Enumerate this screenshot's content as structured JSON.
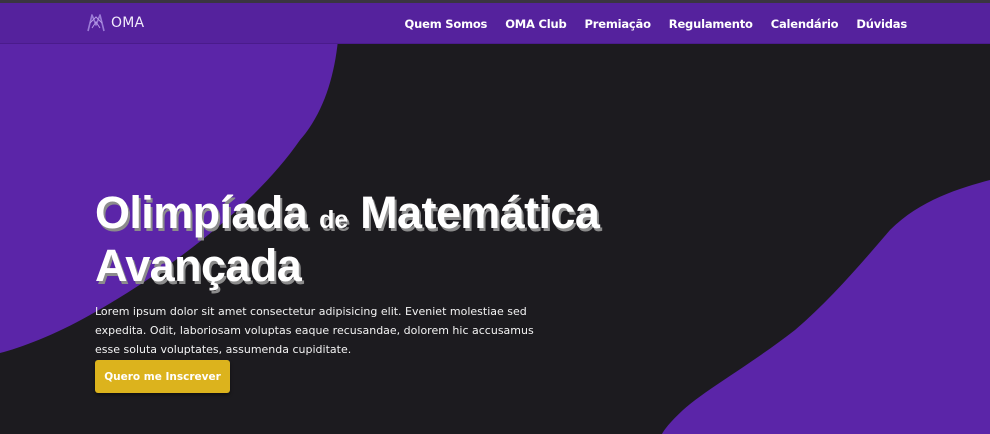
{
  "brand": {
    "name": "OMA",
    "logo_icon": "oma-logo-icon"
  },
  "nav": {
    "items": [
      {
        "label": "Quem Somos"
      },
      {
        "label": "OMA Club"
      },
      {
        "label": "Premiação"
      },
      {
        "label": "Regulamento"
      },
      {
        "label": "Calendário"
      },
      {
        "label": "Dúvidas"
      }
    ]
  },
  "hero": {
    "title_part1": "Olimpíada ",
    "title_small": "de",
    "title_part2": " Matemática Avançada",
    "text": "Lorem ipsum dolor sit amet consectetur adipisicing elit. Eveniet molestiae sed expedita. Odit, laboriosam voluptas eaque recusandae, dolorem hic accusamus esse soluta voluptates, assumenda cupiditate.",
    "cta_label": "Quero me Inscrever"
  },
  "colors": {
    "background": "#1c1b1f",
    "navbar": "#55229d",
    "blob": "#5b25a8",
    "cta": "#dcb31d"
  }
}
